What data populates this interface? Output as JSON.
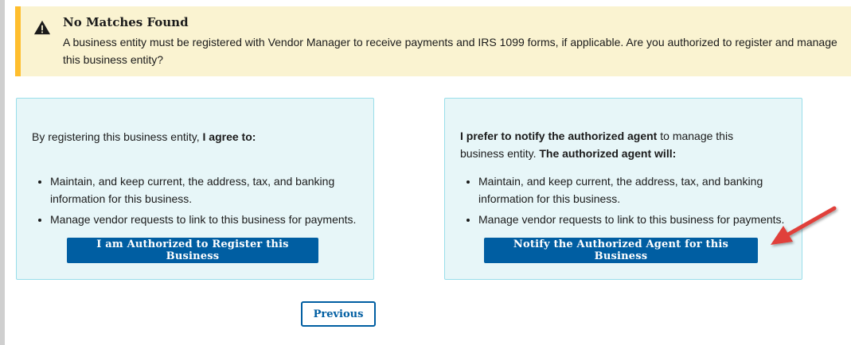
{
  "alert": {
    "icon": "warning-icon",
    "title": "No Matches Found",
    "text": "A business entity must be registered with Vendor Manager to receive payments and IRS 1099 forms, if applicable. Are you authorized to register and manage this business entity?",
    "accent_color": "#ffbe2e",
    "background_color": "#faf3d1"
  },
  "register_card": {
    "intro_prefix": "By registering this business entity, ",
    "intro_bold": "I agree to:",
    "bullets": [
      "Maintain, and keep current, the address, tax, and banking information for this business.",
      "Manage vendor requests to link to this business for payments."
    ],
    "button_label": "I am Authorized to Register this Business"
  },
  "notify_card": {
    "intro_bold": "I prefer to notify the authorized agent",
    "intro_middle": " to manage this business entity. ",
    "intro_bold2": "The authorized agent will:",
    "bullets": [
      "Maintain, and keep current, the address, tax, and banking information for this business.",
      "Manage vendor requests to link to this business for payments."
    ],
    "button_label": "Notify the Authorized Agent for this Business"
  },
  "navigation": {
    "previous_label": "Previous"
  },
  "colors": {
    "primary": "#005ea2",
    "card_background": "#e7f6f8",
    "card_border": "#99deea",
    "annotation_arrow": "#e0403a"
  },
  "annotation": {
    "icon": "red-arrow-icon"
  }
}
